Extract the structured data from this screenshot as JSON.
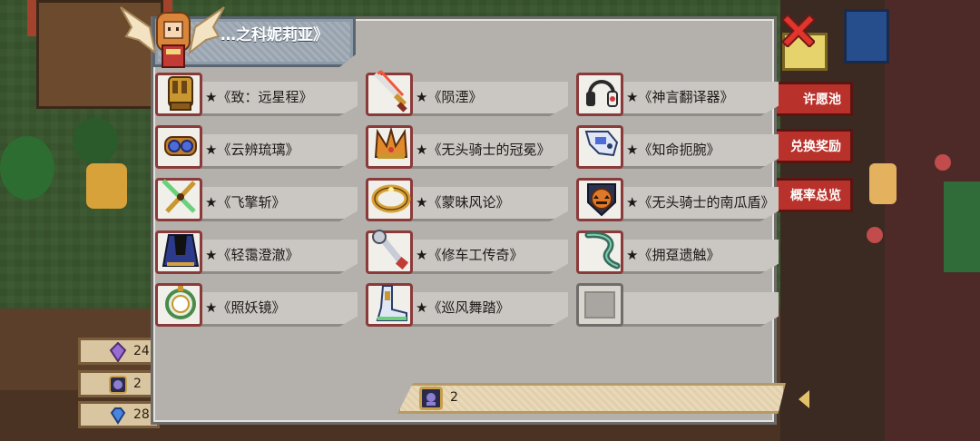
{
  "panel": {
    "title": "…之科妮莉亚》"
  },
  "side_menu": {
    "wish_pool": "许愿池",
    "exchange": "兑换奖励",
    "rates": "概率总览"
  },
  "resources": [
    {
      "name": "gem",
      "value": "24"
    },
    {
      "name": "token",
      "value": "2"
    },
    {
      "name": "diamond",
      "value": "28"
    }
  ],
  "items": [
    {
      "label": "★《致：远星程》",
      "icon": "golden-gauntlet-icon"
    },
    {
      "label": "★《陨湮》",
      "icon": "flaming-sword-icon"
    },
    {
      "label": "★《神言翻译器》",
      "icon": "headset-icon"
    },
    {
      "label": "★《云辨琉璃》",
      "icon": "goggles-icon"
    },
    {
      "label": "★《无头骑士的冠冕》",
      "icon": "crown-icon"
    },
    {
      "label": "★《知命扼腕》",
      "icon": "mech-arm-icon"
    },
    {
      "label": "★《飞擎斩》",
      "icon": "crossed-blades-icon"
    },
    {
      "label": "★《蒙昧风论》",
      "icon": "ring-icon"
    },
    {
      "label": "★《无头骑士的南瓜盾》",
      "icon": "pumpkin-shield-icon"
    },
    {
      "label": "★《轻霭澄澈》",
      "icon": "cloak-icon"
    },
    {
      "label": "★《修车工传奇》",
      "icon": "wrench-icon"
    },
    {
      "label": "★《拥趸遗触》",
      "icon": "tentacle-icon"
    },
    {
      "label": "★《照妖镜》",
      "icon": "mirror-icon"
    },
    {
      "label": "★《巡风舞踏》",
      "icon": "boots-icon"
    },
    {
      "label": "",
      "icon": "empty-slot-icon"
    }
  ],
  "currency": {
    "value": "2",
    "icon": "token-icon"
  },
  "colors": {
    "panel_bg": "#b4b1ad",
    "slot_border": "#8b3a3a",
    "close_red": "#e0342c",
    "side_button": "#b8322b"
  }
}
